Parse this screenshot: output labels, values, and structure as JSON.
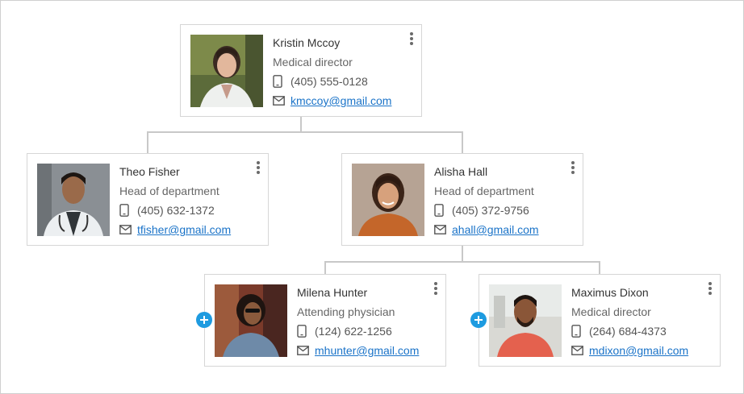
{
  "people": [
    {
      "name": "Kristin Mccoy",
      "role": "Medical director",
      "phone": "(405) 555-0128",
      "email": "kmccoy@gmail.com"
    },
    {
      "name": "Theo Fisher",
      "role": "Head of department",
      "phone": "(405) 632-1372",
      "email": "tfisher@gmail.com"
    },
    {
      "name": "Alisha Hall",
      "role": "Head of department",
      "phone": "(405) 372-9756",
      "email": "ahall@gmail.com"
    },
    {
      "name": "Milena Hunter",
      "role": "Attending physician",
      "phone": "(124) 622-1256",
      "email": "mhunter@gmail.com"
    },
    {
      "name": "Maximus Dixon",
      "role": "Medical director",
      "phone": "(264) 684-4373",
      "email": "mdixon@gmail.com"
    }
  ],
  "icons": {
    "phone": "phone-icon",
    "email": "mail-icon",
    "menu": "more-vertical-icon",
    "expand": "plus-circle-icon"
  },
  "colors": {
    "link": "#1a73c8",
    "expand": "#1e9be0",
    "connector": "#c8c8c8",
    "border": "#d6d6d6"
  }
}
